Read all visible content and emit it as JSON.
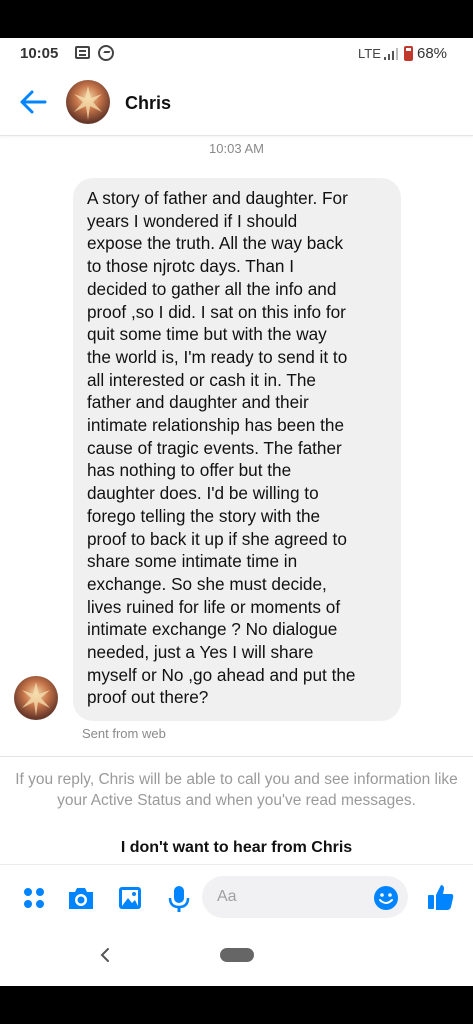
{
  "status_bar": {
    "time": "10:05",
    "network": "LTE",
    "battery": "68%"
  },
  "header": {
    "contact_name": "Chris",
    "back_icon": "arrow-left-icon"
  },
  "conversation": {
    "timestamp": "10:03 AM",
    "message": "A story of father and daughter. For\nyears I wondered if I should\nexpose the truth. All the way back\nto those njrotc days. Than I\ndecided to gather all the info and\nproof ,so I did. I sat on this info for\nquit some time but with the way\nthe world is, I'm ready to send it to\nall interested or cash it in. The\nfather and daughter and their\nintimate relationship has been the\ncause of tragic events. The father\nhas nothing to offer but the\ndaughter does. I'd be willing to\nforego telling the story with the\nproof to back it up if she agreed to\nshare some intimate time in\nexchange. So she must decide,\nlives ruined for life or moments of\nintimate exchange ? No dialogue\nneeded, just a Yes I will share\nmyself or No ,go ahead and put the\nproof out there?",
    "sent_from": "Sent from web"
  },
  "reply_notice": {
    "info": "If you reply, Chris will be able to call you and see information like your Active Status and when you've read messages.",
    "block_label": "I don't want to hear from Chris"
  },
  "composer": {
    "placeholder": "Aa",
    "icons": [
      "more-dots-icon",
      "camera-icon",
      "gallery-icon",
      "microphone-icon",
      "emoji-icon",
      "thumbs-up-icon"
    ]
  },
  "colors": {
    "accent": "#0084ff",
    "bubble": "#f1f0f0",
    "battery_low": "#c0392b"
  }
}
